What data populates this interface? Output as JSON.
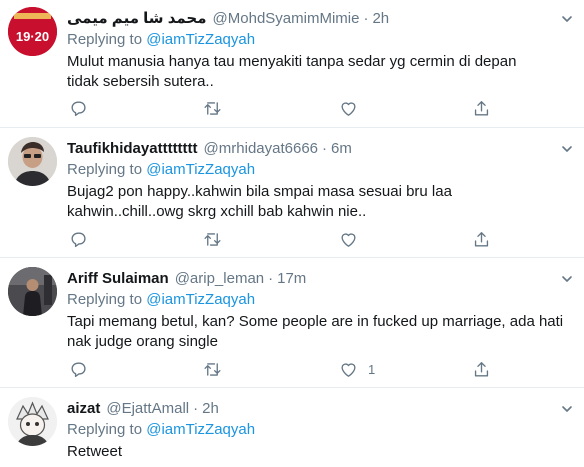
{
  "tweets": [
    {
      "display_name": "محمد شا ميم ميمى",
      "handle": "@MohdSyamimMimie",
      "dot": "·",
      "time": "2h",
      "replying_prefix": "Replying to",
      "replying_to": "@iamTizZaqyah",
      "text": "Mulut manusia hanya tau menyakiti tanpa sedar yg cermin di depan tidak sebersih sutera..",
      "avatar_text": "19·20",
      "likes": ""
    },
    {
      "display_name": "Taufikhidayatttttttt",
      "handle": "@mrhidayat6666",
      "dot": "·",
      "time": "6m",
      "replying_prefix": "Replying to",
      "replying_to": "@iamTizZaqyah",
      "text": "Bujag2 pon happy..kahwin bila smpai masa sesuai bru laa kahwin..chill..owg skrg xchill bab kahwin nie..",
      "likes": ""
    },
    {
      "display_name": "Ariff Sulaiman",
      "handle": "@arip_leman",
      "dot": "·",
      "time": "17m",
      "replying_prefix": "Replying to",
      "replying_to": "@iamTizZaqyah",
      "text": "Tapi memang betul, kan? Some people are in fucked up marriage, ada hati nak judge orang single",
      "likes": "1"
    },
    {
      "display_name": "aizat",
      "handle": "@EjattAmall",
      "dot": "·",
      "time": "2h",
      "replying_prefix": "Replying to",
      "replying_to": "@iamTizZaqyah",
      "text": "Retweet",
      "likes": ""
    }
  ],
  "icons": {
    "reply": "reply-icon",
    "retweet": "retweet-icon",
    "like": "like-icon",
    "share": "share-icon",
    "caret": "chevron-down-icon"
  },
  "colors": {
    "link": "#1b95e0",
    "secondary_text": "#657786",
    "divider": "#e6ecf0",
    "avatar1_bg": "#c8102e"
  }
}
